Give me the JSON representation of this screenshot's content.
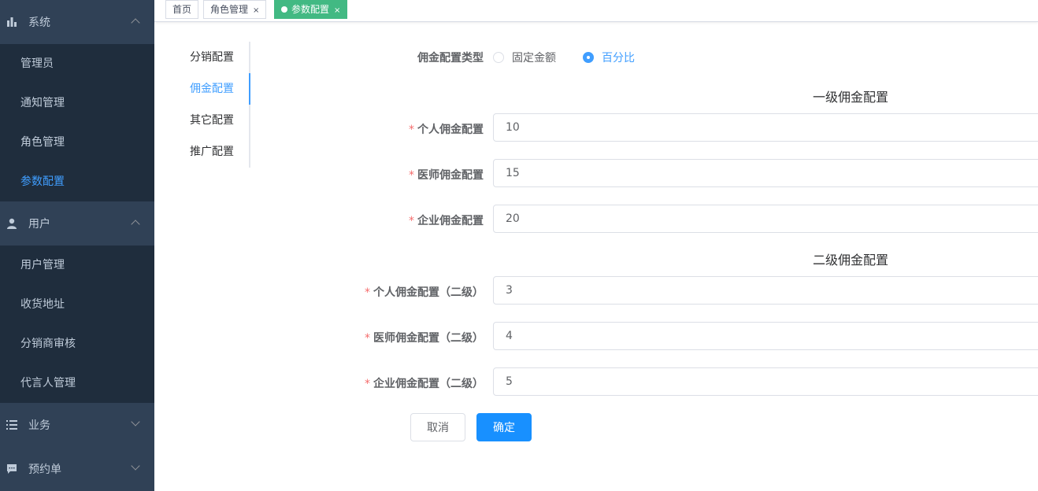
{
  "sidebar": {
    "groups": [
      {
        "title": "系统",
        "icon": "bar-chart-icon",
        "expanded": true,
        "items": [
          "管理员",
          "通知管理",
          "角色管理",
          "参数配置"
        ],
        "active": "参数配置"
      },
      {
        "title": "用户",
        "icon": "user-icon",
        "expanded": true,
        "items": [
          "用户管理",
          "收货地址",
          "分销商审核",
          "代言人管理"
        ]
      },
      {
        "title": "业务",
        "icon": "list-icon",
        "expanded": false
      },
      {
        "title": "预约单",
        "icon": "chat-icon",
        "expanded": false
      }
    ]
  },
  "tags": [
    {
      "label": "首页"
    },
    {
      "label": "角色管理",
      "close": "×"
    },
    {
      "label": "参数配置",
      "close": "×",
      "active": true
    }
  ],
  "tabs": [
    "分销配置",
    "佣金配置",
    "其它配置",
    "推广配置"
  ],
  "active_tab": "佣金配置",
  "form": {
    "type_label": "佣金配置类型",
    "type_options": [
      "固定金额",
      "百分比"
    ],
    "type_selected": "百分比",
    "required_mark": "*",
    "level1_title": "一级佣金配置",
    "level2_title": "二级佣金配置",
    "fields": [
      {
        "label": "个人佣金配置",
        "value": "10"
      },
      {
        "label": "医师佣金配置",
        "value": "15"
      },
      {
        "label": "企业佣金配置",
        "value": "20"
      },
      {
        "label": "个人佣金配置（二级）",
        "value": "3"
      },
      {
        "label": "医师佣金配置（二级）",
        "value": "4"
      },
      {
        "label": "企业佣金配置（二级）",
        "value": "5"
      }
    ],
    "cancel_label": "取消",
    "confirm_label": "确定"
  },
  "colors": {
    "sidebar_bg": "#304156",
    "submenu_bg": "#1f2d3d",
    "accent": "#409eff",
    "tag_active": "#42b983",
    "primary_button": "#1890ff"
  }
}
